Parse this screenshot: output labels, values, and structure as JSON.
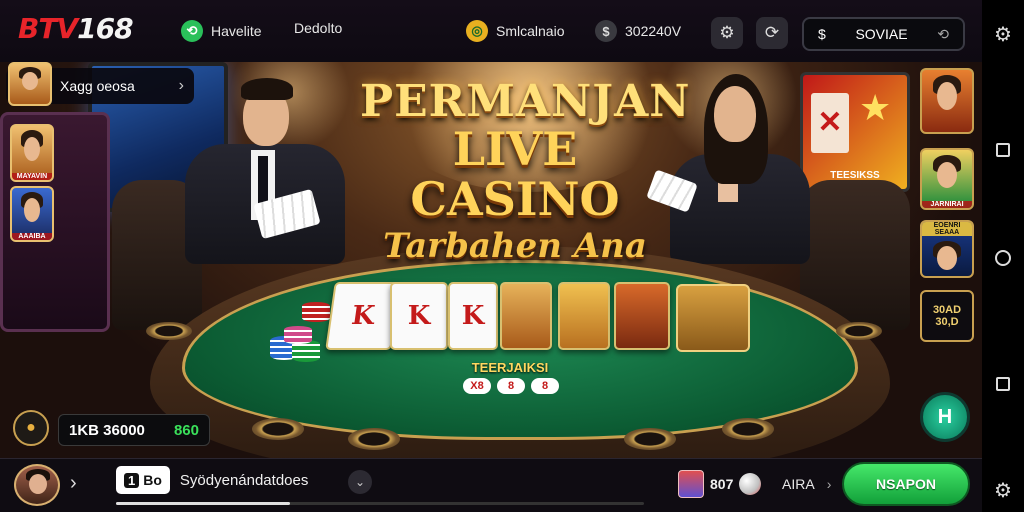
{
  "brand": {
    "logo_part1": "BTV",
    "logo_part2": "168"
  },
  "header": {
    "nav_favorite": "Havelite",
    "nav_deposit": "Dedolto",
    "nav_simulasi": "Smlcalnaio",
    "nav_coins": "302240V",
    "account_label": "SOVIAE"
  },
  "title": {
    "line1": "PERMANJAN",
    "line2": "LIVE CASINO",
    "line3": "Tarbahen Ana"
  },
  "left_chip": {
    "label": "Xagg oeosa"
  },
  "left_tiles": {
    "tile1_caption": "MAYAVIN",
    "tile2_caption": "AAAIBA"
  },
  "right_tiles": {
    "tile2_caption": "JARNIRAI",
    "tile3_caption": "EOENRI SEAAA",
    "tile4_caption": "30AD 30,D"
  },
  "table": {
    "label": "TEERJAIKSI",
    "dots": [
      "X8",
      "8",
      "8"
    ],
    "card_faces": [
      "K",
      "K",
      "K"
    ]
  },
  "promo_right": {
    "text": "TEESIKSS"
  },
  "balance": {
    "amount": "1KB 36000",
    "extra": "860"
  },
  "bottom": {
    "room_tag_icon": "1",
    "room_tag_text": "Bo",
    "room_name": "Syödyenándatdoes",
    "gift_count": "807",
    "aria": "AIRA",
    "cta_label": "NSAPON",
    "progress": 0.33
  },
  "colors": {
    "accent_red": "#e8242a",
    "felt_green": "#0b5a32",
    "cta_green": "#12a03a",
    "gold": "#c8a050"
  },
  "icons": [
    "gear-icon",
    "refresh-icon",
    "dollar-icon",
    "chevron-right-icon",
    "chevron-down-icon",
    "android-square",
    "android-circle"
  ]
}
